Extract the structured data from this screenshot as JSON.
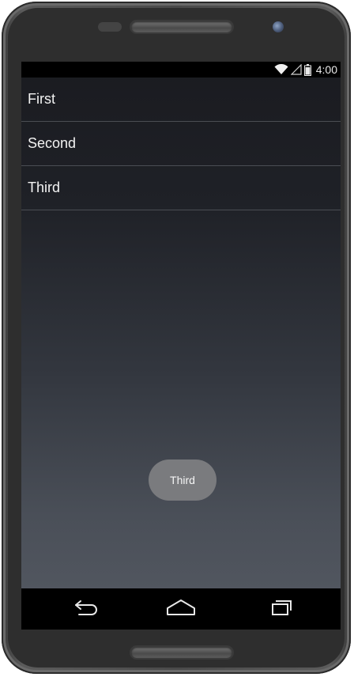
{
  "status_bar": {
    "time": "4:00",
    "icons": [
      "wifi-icon",
      "signal-icon",
      "battery-icon"
    ]
  },
  "list": {
    "items": [
      {
        "label": "First"
      },
      {
        "label": "Second"
      },
      {
        "label": "Third"
      }
    ]
  },
  "toast": {
    "text": "Third"
  },
  "nav_bar": {
    "buttons": [
      "back-icon",
      "home-icon",
      "recent-apps-icon"
    ]
  }
}
